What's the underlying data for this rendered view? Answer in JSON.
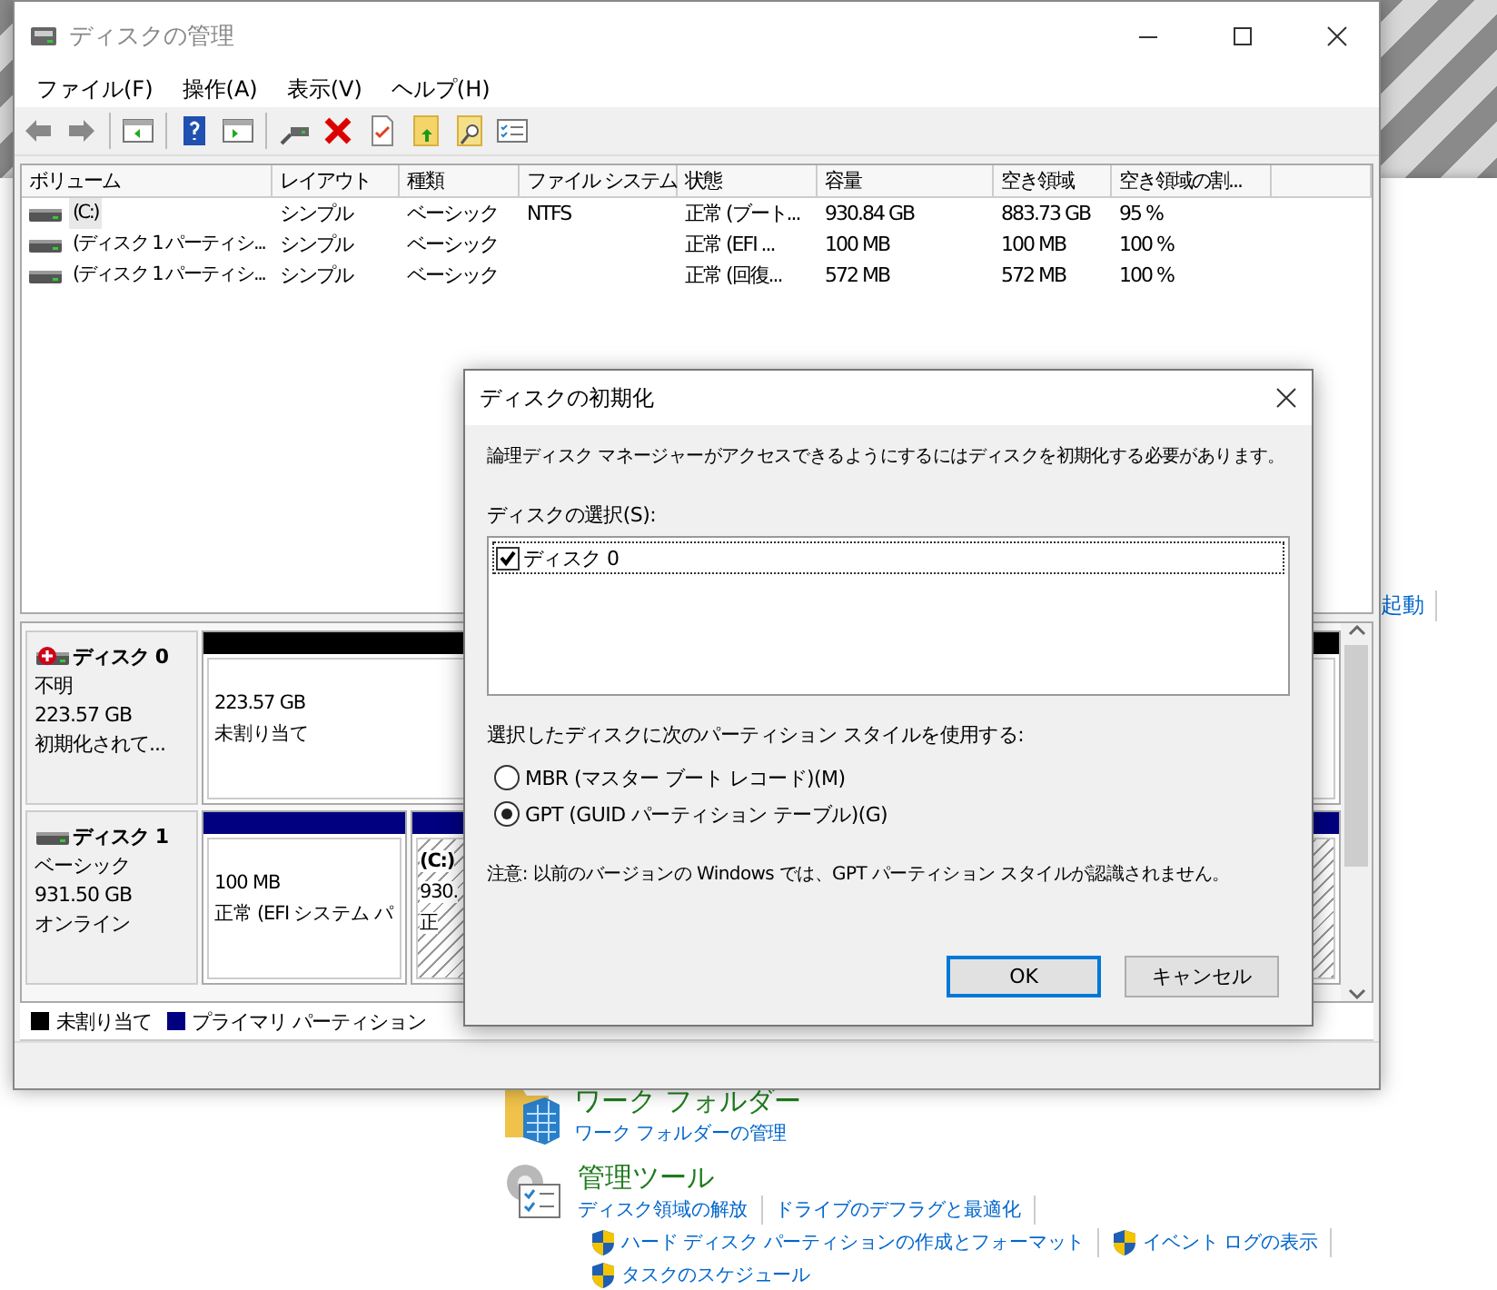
{
  "control_panel": {
    "partial_link": "起動",
    "sections": [
      {
        "kind": "folders",
        "title": "ワーク フォルダー",
        "links": [
          {
            "text": "ワーク フォルダーの管理",
            "shield": false
          }
        ]
      },
      {
        "kind": "tools",
        "title": "管理ツール",
        "links": [
          {
            "text": "ディスク領域の解放",
            "shield": false
          },
          {
            "text": "ドライブのデフラグと最適化",
            "shield": false
          },
          {
            "text": "ハード ディスク パーティションの作成とフォーマット",
            "shield": true
          },
          {
            "text": "イベント ログの表示",
            "shield": true
          },
          {
            "text": "タスクのスケジュール",
            "shield": true
          }
        ]
      }
    ]
  },
  "window": {
    "title": "ディスクの管理"
  },
  "menu": [
    "ファイル(F)",
    "操作(A)",
    "表示(V)",
    "ヘルプ(H)"
  ],
  "volume_table": {
    "columns": [
      "ボリューム",
      "レイアウト",
      "種類",
      "ファイル システム",
      "状態",
      "容量",
      "空き領域",
      "空き領域の割..."
    ],
    "rows": [
      {
        "selected": true,
        "cells": [
          "(C:)",
          "シンプル",
          "ベーシック",
          "NTFS",
          "正常 (ブート...",
          "930.84 GB",
          "883.73 GB",
          "95 %"
        ]
      },
      {
        "selected": false,
        "cells": [
          "(ディスク 1 パーティシ...",
          "シンプル",
          "ベーシック",
          "",
          "正常 (EFI ...",
          "100 MB",
          "100 MB",
          "100 %"
        ]
      },
      {
        "selected": false,
        "cells": [
          "(ディスク 1 パーティシ...",
          "シンプル",
          "ベーシック",
          "",
          "正常 (回復...",
          "572 MB",
          "572 MB",
          "100 %"
        ]
      }
    ]
  },
  "disks": [
    {
      "name": "ディスク 0",
      "kind": "error",
      "lines": [
        "不明",
        "223.57 GB",
        "初期化されて..."
      ],
      "partitions": [
        {
          "color": "#000000",
          "selected": false,
          "size": "223.57 GB",
          "status": "未割り当て"
        }
      ]
    },
    {
      "name": "ディスク 1",
      "kind": "online",
      "lines": [
        "ベーシック",
        "931.50 GB",
        "オンライン"
      ],
      "partitions": [
        {
          "color": "#000080",
          "selected": false,
          "size": "100 MB",
          "status": "正常 (EFI システム パ"
        },
        {
          "color": "#000080",
          "selected": true,
          "label": "(C:)",
          "size": "930.",
          "status": "正"
        }
      ]
    }
  ],
  "legend": [
    {
      "label": "未割り当て",
      "color": "#000000"
    },
    {
      "label": "プライマリ パーティション",
      "color": "#000080"
    }
  ],
  "dialog": {
    "title": "ディスクの初期化",
    "message": "論理ディスク マネージャーがアクセスできるようにするにはディスクを初期化する必要があります。",
    "disk_list_label": "ディスクの選択(S):",
    "disks": [
      {
        "label": "ディスク 0",
        "checked": true
      }
    ],
    "style_label": "選択したディスクに次のパーティション スタイルを使用する:",
    "styles": [
      {
        "label": "MBR (マスター ブート レコード)(M)",
        "selected": false
      },
      {
        "label": "GPT (GUID パーティション テーブル)(G)",
        "selected": true
      }
    ],
    "note": "注意: 以前のバージョンの Windows では、GPT パーティション スタイルが認識されません。",
    "buttons": [
      {
        "label": "OK",
        "default": true
      },
      {
        "label": "キャンセル",
        "default": false
      }
    ]
  }
}
